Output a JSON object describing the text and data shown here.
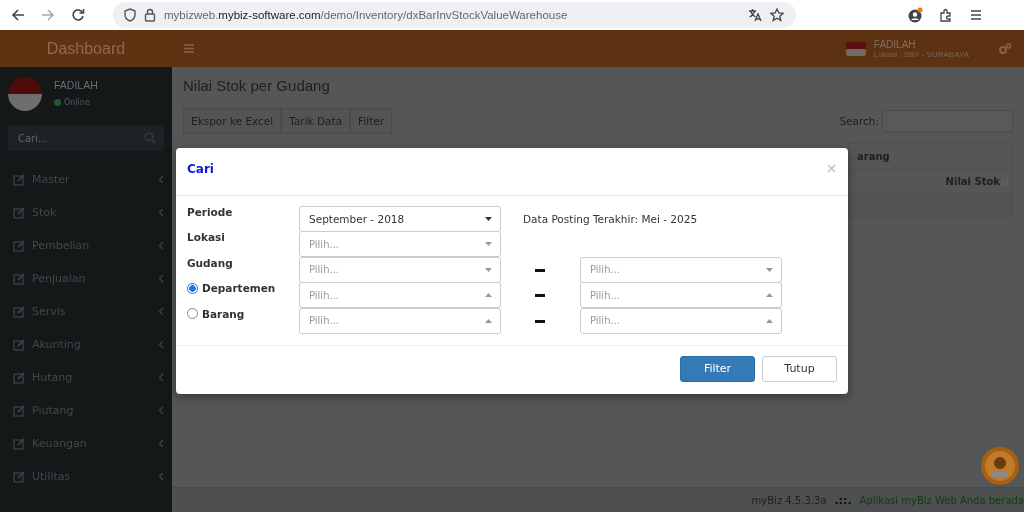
{
  "browser": {
    "url": "mybizweb.**mybiz-software.com**/demo/Inventory/dxBarInvStockValueWarehouse"
  },
  "header": {
    "brand": "Dashboard",
    "user": "FADILAH",
    "location": "Lokasi : SBY - SURABAYA"
  },
  "sidebar": {
    "user": "FADILAH",
    "status": "Online",
    "search_placeholder": "Cari...",
    "items": [
      {
        "label": "Master"
      },
      {
        "label": "Stok"
      },
      {
        "label": "Pembelian"
      },
      {
        "label": "Penjualan"
      },
      {
        "label": "Servis"
      },
      {
        "label": "Akunting"
      },
      {
        "label": "Hutang"
      },
      {
        "label": "Piutang"
      },
      {
        "label": "Keuangan"
      },
      {
        "label": "Utilitas"
      }
    ]
  },
  "page": {
    "title": "Nilai Stok per Gudang",
    "toolbar": [
      "Ekspor ke Excel",
      "Tarik Data",
      "Filter"
    ],
    "search_label": "Search:",
    "table": {
      "group_header": "arang",
      "columns": [
        "Nilai Stok"
      ]
    }
  },
  "modal": {
    "title": "Cari",
    "posting_note": "Data Posting Terakhir: Mei - 2025",
    "fields": [
      {
        "label": "Periode",
        "kind": "label",
        "from": {
          "value": "September - 2018",
          "expanded": false
        }
      },
      {
        "label": "Lokasi",
        "kind": "label",
        "from": {
          "placeholder": "Pilih...",
          "expanded": false
        }
      },
      {
        "label": "Gudang",
        "kind": "label",
        "from": {
          "placeholder": "Pilih...",
          "expanded": false
        },
        "to": {
          "placeholder": "Pilih...",
          "expanded": false
        }
      },
      {
        "label": "Departemen",
        "kind": "radio",
        "selected": true,
        "from": {
          "placeholder": "Pilih...",
          "expanded": true
        },
        "to": {
          "placeholder": "Pilih...",
          "expanded": true
        }
      },
      {
        "label": "Barang",
        "kind": "radio",
        "selected": false,
        "from": {
          "placeholder": "Pilih...",
          "expanded": true
        },
        "to": {
          "placeholder": "Pilih...",
          "expanded": true
        }
      }
    ],
    "buttons": [
      {
        "label": "Filter",
        "kind": "primary"
      },
      {
        "label": "Tutup",
        "kind": "default"
      }
    ]
  },
  "footer": {
    "version": "myBiz 4.5.3.3a",
    "separator": ".::.",
    "message": "Aplikasi myBiz Web Anda berada"
  }
}
